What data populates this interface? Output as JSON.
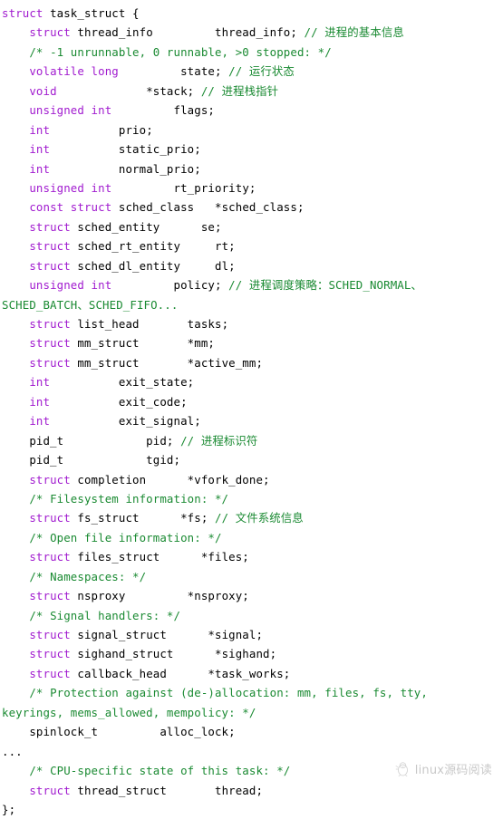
{
  "document": {
    "kind": "source-code-listing",
    "language": "c",
    "title": "struct task_struct",
    "colors": {
      "background": "#ffffff",
      "keyword": "#a11bcf",
      "identifier": "#000000",
      "comment": "#1a8a32"
    }
  },
  "code": {
    "lines": [
      [
        {
          "t": "kw",
          "s": "struct"
        },
        {
          "t": "plain",
          "s": " task_struct {"
        }
      ],
      [
        {
          "t": "plain",
          "s": "    "
        },
        {
          "t": "kw",
          "s": "struct"
        },
        {
          "t": "plain",
          "s": " thread_info         thread_info; "
        },
        {
          "t": "cmt",
          "s": "// 进程的基本信息"
        }
      ],
      [
        {
          "t": "plain",
          "s": "    "
        },
        {
          "t": "cmt",
          "s": "/* -1 unrunnable, 0 runnable, >0 stopped: */"
        }
      ],
      [
        {
          "t": "plain",
          "s": "    "
        },
        {
          "t": "kw",
          "s": "volatile long"
        },
        {
          "t": "plain",
          "s": "         state; "
        },
        {
          "t": "cmt",
          "s": "// 运行状态"
        }
      ],
      [
        {
          "t": "plain",
          "s": "    "
        },
        {
          "t": "kw",
          "s": "void"
        },
        {
          "t": "plain",
          "s": "             *stack; "
        },
        {
          "t": "cmt",
          "s": "// 进程栈指针"
        }
      ],
      [
        {
          "t": "plain",
          "s": "    "
        },
        {
          "t": "kw",
          "s": "unsigned int"
        },
        {
          "t": "plain",
          "s": "         flags;"
        }
      ],
      [
        {
          "t": "plain",
          "s": "    "
        },
        {
          "t": "kw",
          "s": "int"
        },
        {
          "t": "plain",
          "s": "          prio;"
        }
      ],
      [
        {
          "t": "plain",
          "s": "    "
        },
        {
          "t": "kw",
          "s": "int"
        },
        {
          "t": "plain",
          "s": "          static_prio;"
        }
      ],
      [
        {
          "t": "plain",
          "s": "    "
        },
        {
          "t": "kw",
          "s": "int"
        },
        {
          "t": "plain",
          "s": "          normal_prio;"
        }
      ],
      [
        {
          "t": "plain",
          "s": "    "
        },
        {
          "t": "kw",
          "s": "unsigned int"
        },
        {
          "t": "plain",
          "s": "         rt_priority;"
        }
      ],
      [
        {
          "t": "plain",
          "s": "    "
        },
        {
          "t": "kw",
          "s": "const struct"
        },
        {
          "t": "plain",
          "s": " sched_class   *sched_class;"
        }
      ],
      [
        {
          "t": "plain",
          "s": "    "
        },
        {
          "t": "kw",
          "s": "struct"
        },
        {
          "t": "plain",
          "s": " sched_entity      se;"
        }
      ],
      [
        {
          "t": "plain",
          "s": "    "
        },
        {
          "t": "kw",
          "s": "struct"
        },
        {
          "t": "plain",
          "s": " sched_rt_entity     rt;"
        }
      ],
      [
        {
          "t": "plain",
          "s": "    "
        },
        {
          "t": "kw",
          "s": "struct"
        },
        {
          "t": "plain",
          "s": " sched_dl_entity     dl;"
        }
      ],
      [
        {
          "t": "plain",
          "s": "    "
        },
        {
          "t": "kw",
          "s": "unsigned int"
        },
        {
          "t": "plain",
          "s": "         policy; "
        },
        {
          "t": "cmt",
          "s": "// 进程调度策略：SCHED_NORMAL、"
        }
      ],
      [
        {
          "t": "cmt",
          "s": "SCHED_BATCH、SCHED_FIFO..."
        }
      ],
      [
        {
          "t": "plain",
          "s": "    "
        },
        {
          "t": "kw",
          "s": "struct"
        },
        {
          "t": "plain",
          "s": " list_head       tasks;"
        }
      ],
      [
        {
          "t": "plain",
          "s": "    "
        },
        {
          "t": "kw",
          "s": "struct"
        },
        {
          "t": "plain",
          "s": " mm_struct       *mm;"
        }
      ],
      [
        {
          "t": "plain",
          "s": "    "
        },
        {
          "t": "kw",
          "s": "struct"
        },
        {
          "t": "plain",
          "s": " mm_struct       *active_mm;"
        }
      ],
      [
        {
          "t": "plain",
          "s": "    "
        },
        {
          "t": "kw",
          "s": "int"
        },
        {
          "t": "plain",
          "s": "          exit_state;"
        }
      ],
      [
        {
          "t": "plain",
          "s": "    "
        },
        {
          "t": "kw",
          "s": "int"
        },
        {
          "t": "plain",
          "s": "          exit_code;"
        }
      ],
      [
        {
          "t": "plain",
          "s": "    "
        },
        {
          "t": "kw",
          "s": "int"
        },
        {
          "t": "plain",
          "s": "          exit_signal;"
        }
      ],
      [
        {
          "t": "plain",
          "s": "    pid_t            pid; "
        },
        {
          "t": "cmt",
          "s": "// 进程标识符"
        }
      ],
      [
        {
          "t": "plain",
          "s": "    pid_t            tgid;"
        }
      ],
      [
        {
          "t": "plain",
          "s": "    "
        },
        {
          "t": "kw",
          "s": "struct"
        },
        {
          "t": "plain",
          "s": " completion      *vfork_done;"
        }
      ],
      [
        {
          "t": "plain",
          "s": "    "
        },
        {
          "t": "cmt",
          "s": "/* Filesystem information: */"
        }
      ],
      [
        {
          "t": "plain",
          "s": "    "
        },
        {
          "t": "kw",
          "s": "struct"
        },
        {
          "t": "plain",
          "s": " fs_struct      *fs; "
        },
        {
          "t": "cmt",
          "s": "// 文件系统信息"
        }
      ],
      [
        {
          "t": "plain",
          "s": "    "
        },
        {
          "t": "cmt",
          "s": "/* Open file information: */"
        }
      ],
      [
        {
          "t": "plain",
          "s": "    "
        },
        {
          "t": "kw",
          "s": "struct"
        },
        {
          "t": "plain",
          "s": " files_struct      *files;"
        }
      ],
      [
        {
          "t": "plain",
          "s": "    "
        },
        {
          "t": "cmt",
          "s": "/* Namespaces: */"
        }
      ],
      [
        {
          "t": "plain",
          "s": "    "
        },
        {
          "t": "kw",
          "s": "struct"
        },
        {
          "t": "plain",
          "s": " nsproxy         *nsproxy;"
        }
      ],
      [
        {
          "t": "plain",
          "s": "    "
        },
        {
          "t": "cmt",
          "s": "/* Signal handlers: */"
        }
      ],
      [
        {
          "t": "plain",
          "s": "    "
        },
        {
          "t": "kw",
          "s": "struct"
        },
        {
          "t": "plain",
          "s": " signal_struct      *signal;"
        }
      ],
      [
        {
          "t": "plain",
          "s": "    "
        },
        {
          "t": "kw",
          "s": "struct"
        },
        {
          "t": "plain",
          "s": " sighand_struct      *sighand;"
        }
      ],
      [
        {
          "t": "plain",
          "s": "    "
        },
        {
          "t": "kw",
          "s": "struct"
        },
        {
          "t": "plain",
          "s": " callback_head      *task_works;"
        }
      ],
      [
        {
          "t": "plain",
          "s": "    "
        },
        {
          "t": "cmt",
          "s": "/* Protection against (de-)allocation: mm, files, fs, tty,"
        }
      ],
      [
        {
          "t": "cmt",
          "s": "keyrings, mems_allowed, mempolicy: */"
        }
      ],
      [
        {
          "t": "plain",
          "s": "    spinlock_t         alloc_lock;"
        }
      ],
      [
        {
          "t": "plain",
          "s": "..."
        }
      ],
      [
        {
          "t": "plain",
          "s": "    "
        },
        {
          "t": "cmt",
          "s": "/* CPU-specific state of this task: */"
        }
      ],
      [
        {
          "t": "plain",
          "s": "    "
        },
        {
          "t": "kw",
          "s": "struct"
        },
        {
          "t": "plain",
          "s": " thread_struct       thread;"
        }
      ],
      [
        {
          "t": "plain",
          "s": "};"
        }
      ]
    ]
  },
  "watermark": {
    "label": "linux源码阅读",
    "icon": "penguin-icon"
  }
}
